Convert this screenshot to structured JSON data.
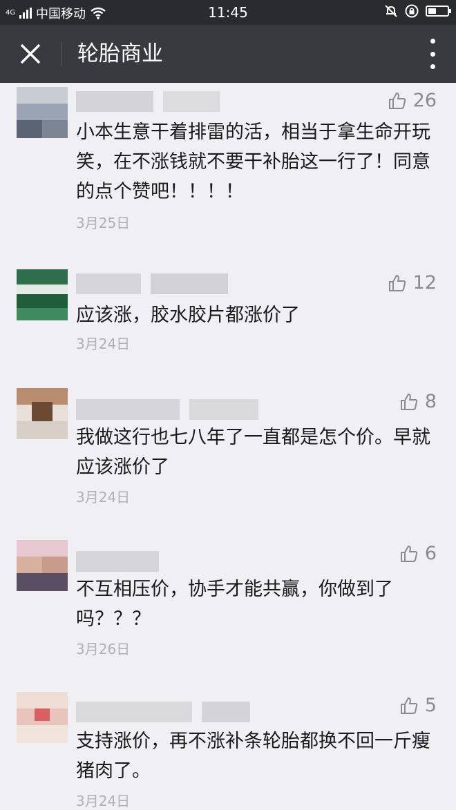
{
  "status_bar": {
    "network": "4G",
    "carrier": "中国移动",
    "time": "11:45"
  },
  "header": {
    "title": "轮胎商业",
    "close_icon": "close-icon",
    "more_icon": "more-vertical-icon"
  },
  "colors": {
    "status_bar_bg": "#2a2b2f",
    "header_bg": "#393a3f",
    "page_bg": "#efeff4",
    "like_color": "#8a8a8f"
  },
  "comments": [
    {
      "likes": "26",
      "text": "小本生意干着排雷的活，相当于拿生命开玩笑，在不涨钱就不要干补胎这一行了！同意的点个赞吧！！！！",
      "date": "3月25日"
    },
    {
      "likes": "12",
      "text": "应该涨，胶水胶片都涨价了",
      "date": "3月24日"
    },
    {
      "likes": "8",
      "text": "我做这行也七八年了一直都是怎个价。早就应该涨价了",
      "date": "3月24日"
    },
    {
      "likes": "6",
      "text": "不互相压价，协手才能共赢，你做到了吗？？？",
      "date": "3月26日"
    },
    {
      "likes": "5",
      "text": "支持涨价，再不涨补条轮胎都换不回一斤瘦猪肉了。",
      "date": "3月24日"
    }
  ]
}
